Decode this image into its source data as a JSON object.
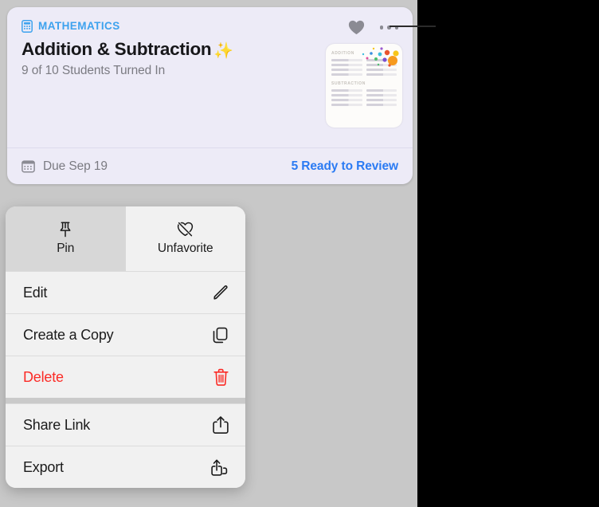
{
  "card": {
    "subject": {
      "icon": "calculator-icon",
      "label": "MATHEMATICS",
      "color": "#3da2ee"
    },
    "title": "Addition & Subtraction",
    "title_emoji": "✨",
    "subtitle": "9 of 10 Students Turned In",
    "actions": {
      "favorite_icon": "heart-filled-icon",
      "more_icon": "ellipsis-icon"
    },
    "thumbnail": {
      "heading_1": "ADDITION",
      "heading_2": "SUBTRACTION"
    },
    "footer": {
      "due_icon": "calendar-icon",
      "due_text": "Due Sep 19",
      "review_link": "5 Ready to Review",
      "review_link_color": "#2b7bf3"
    },
    "background_color": "#edebf7"
  },
  "context_menu": {
    "top_actions": [
      {
        "label": "Pin",
        "icon": "pin-icon",
        "selected": true
      },
      {
        "label": "Unfavorite",
        "icon": "heart-slash-icon",
        "selected": false
      }
    ],
    "groups": [
      {
        "items": [
          {
            "label": "Edit",
            "icon": "pencil-icon",
            "destructive": false
          },
          {
            "label": "Create a Copy",
            "icon": "duplicate-icon",
            "destructive": false
          },
          {
            "label": "Delete",
            "icon": "trash-icon",
            "destructive": true
          }
        ]
      },
      {
        "items": [
          {
            "label": "Share Link",
            "icon": "share-icon",
            "destructive": false
          },
          {
            "label": "Export",
            "icon": "export-stacked-icon",
            "destructive": false
          }
        ]
      }
    ],
    "destructive_color": "#fb2b26"
  }
}
